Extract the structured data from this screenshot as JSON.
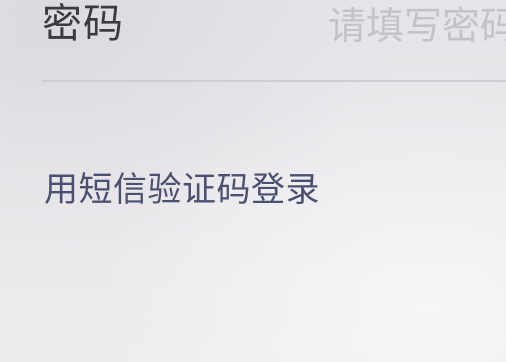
{
  "password_field": {
    "label": "密码",
    "placeholder": "请填写密码",
    "value": ""
  },
  "sms_login": {
    "label": "用短信验证码登录"
  },
  "colors": {
    "label_text": "#3b3b44",
    "placeholder_text": "#c4c3c8",
    "link_text": "#4a5072",
    "divider": "#cfcdd2",
    "background": "#e8e6e9"
  }
}
